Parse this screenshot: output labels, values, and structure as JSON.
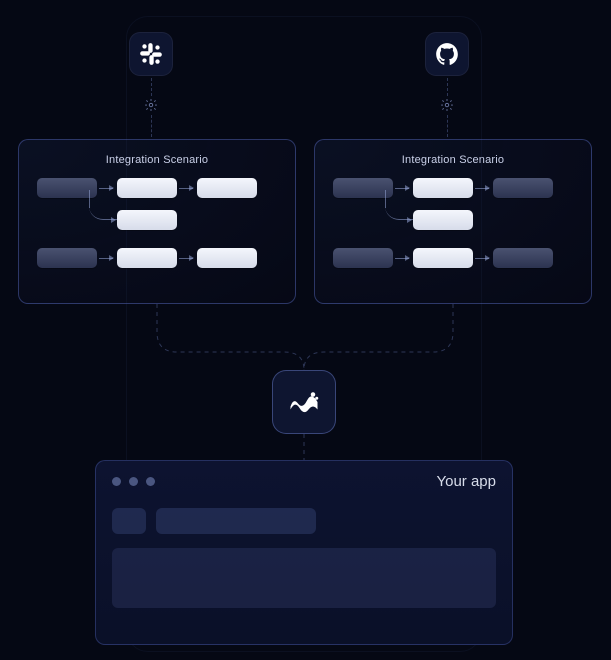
{
  "icons": {
    "slack_name": "slack",
    "github_name": "github",
    "brand_name": "workflow-app"
  },
  "gear_label": "configure",
  "panels": {
    "left": {
      "title": "Integration Scenario"
    },
    "right": {
      "title": "Integration Scenario"
    }
  },
  "window": {
    "title": "Your app"
  }
}
